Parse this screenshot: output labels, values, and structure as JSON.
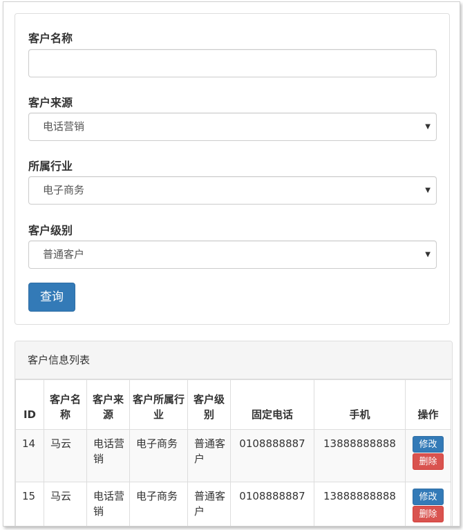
{
  "search": {
    "name_label": "客户名称",
    "name_value": "",
    "source_label": "客户来源",
    "source_selected": "电话营销",
    "industry_label": "所属行业",
    "industry_selected": "电子商务",
    "level_label": "客户级别",
    "level_selected": "普通客户",
    "query_button": "查询"
  },
  "list": {
    "heading": "客户信息列表",
    "columns": [
      "ID",
      "客户名称",
      "客户来源",
      "客户所属行业",
      "客户级别",
      "固定电话",
      "手机",
      "操作"
    ],
    "rows": [
      {
        "id": "14",
        "name": "马云",
        "source": "电话营销",
        "industry": "电子商务",
        "level": "普通客户",
        "phone": "0108888887",
        "mobile": "13888888888",
        "edit": "修改",
        "delete": "删除"
      },
      {
        "id": "15",
        "name": "马云",
        "source": "电话营销",
        "industry": "电子商务",
        "level": "普通客户",
        "phone": "0108888887",
        "mobile": "13888888888",
        "edit": "修改",
        "delete": "删除"
      }
    ]
  },
  "colors": {
    "primary": "#337ab7",
    "danger": "#d9534f"
  }
}
